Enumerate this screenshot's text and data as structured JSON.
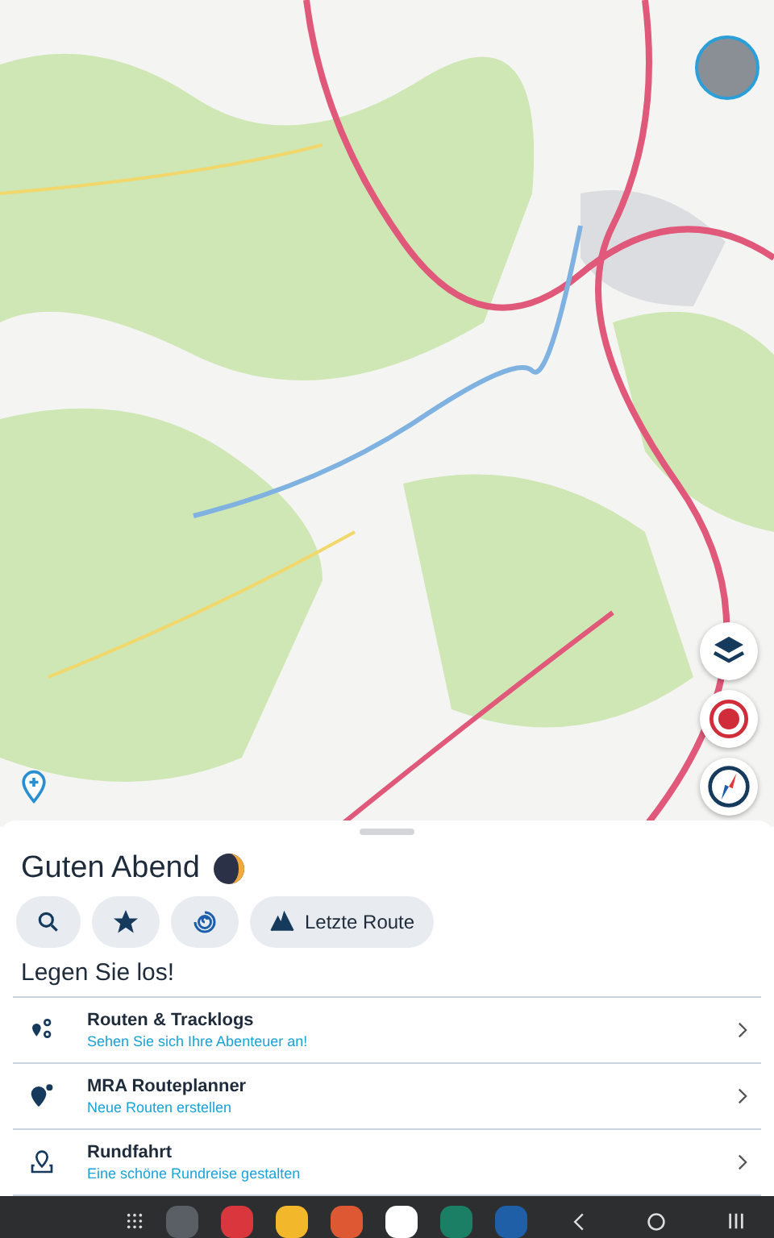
{
  "greeting": {
    "title": "Guten Abend"
  },
  "quick_actions": [
    {
      "kind": "search"
    },
    {
      "kind": "favorites"
    },
    {
      "kind": "spiral"
    },
    {
      "kind": "route",
      "label": "Letzte Route"
    }
  ],
  "section_title": "Legen Sie los!",
  "menu": [
    {
      "kind": "routes",
      "title": "Routen & Tracklogs",
      "subtitle": "Sehen Sie sich Ihre Abenteuer an!"
    },
    {
      "kind": "planner",
      "title": "MRA Routeplanner",
      "subtitle": "Neue Routen erstellen"
    },
    {
      "kind": "roundtrip",
      "title": "Rundfahrt",
      "subtitle": "Eine schöne Rundreise gestalten"
    }
  ],
  "taskbar": [
    {
      "color": "#5a5f66"
    },
    {
      "color": "#d9363e"
    },
    {
      "color": "#f2b72b"
    },
    {
      "color": "#de5833"
    },
    {
      "color": "#ffffff"
    },
    {
      "color": "#1a7f64"
    },
    {
      "color": "#1f5fa8"
    }
  ]
}
